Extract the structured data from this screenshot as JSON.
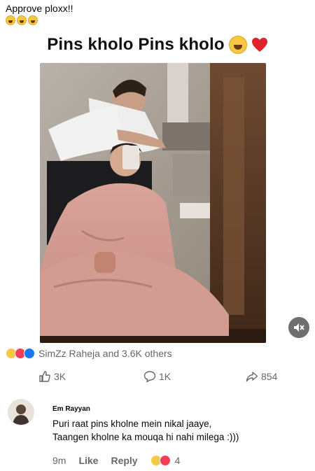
{
  "post": {
    "caption": "Approve ploxx!!",
    "caption_emojis": [
      "laughing-face",
      "laughing-face",
      "laughing-face"
    ],
    "title": "Pins kholo Pins kholo",
    "title_emojis": [
      "laughing-face",
      "red-heart"
    ]
  },
  "reactions": {
    "summary": "SimZz Raheja and 3.6K others",
    "icons": [
      "haha",
      "love",
      "like"
    ]
  },
  "actions": {
    "likes": "3K",
    "comments": "1K",
    "shares": "854"
  },
  "comment": {
    "author": "Em Rayyan",
    "line1": "Puri raat pins kholne mein nikal jaaye,",
    "line2": "Taangen kholne ka mouqa hi nahi milega :)))",
    "time": "9m",
    "like_label": "Like",
    "reply_label": "Reply",
    "reaction_count": "4"
  },
  "colors": {
    "accent": "#1877f2",
    "love": "#f33e58",
    "haha": "#f7c843",
    "muted_text": "#65676b"
  }
}
